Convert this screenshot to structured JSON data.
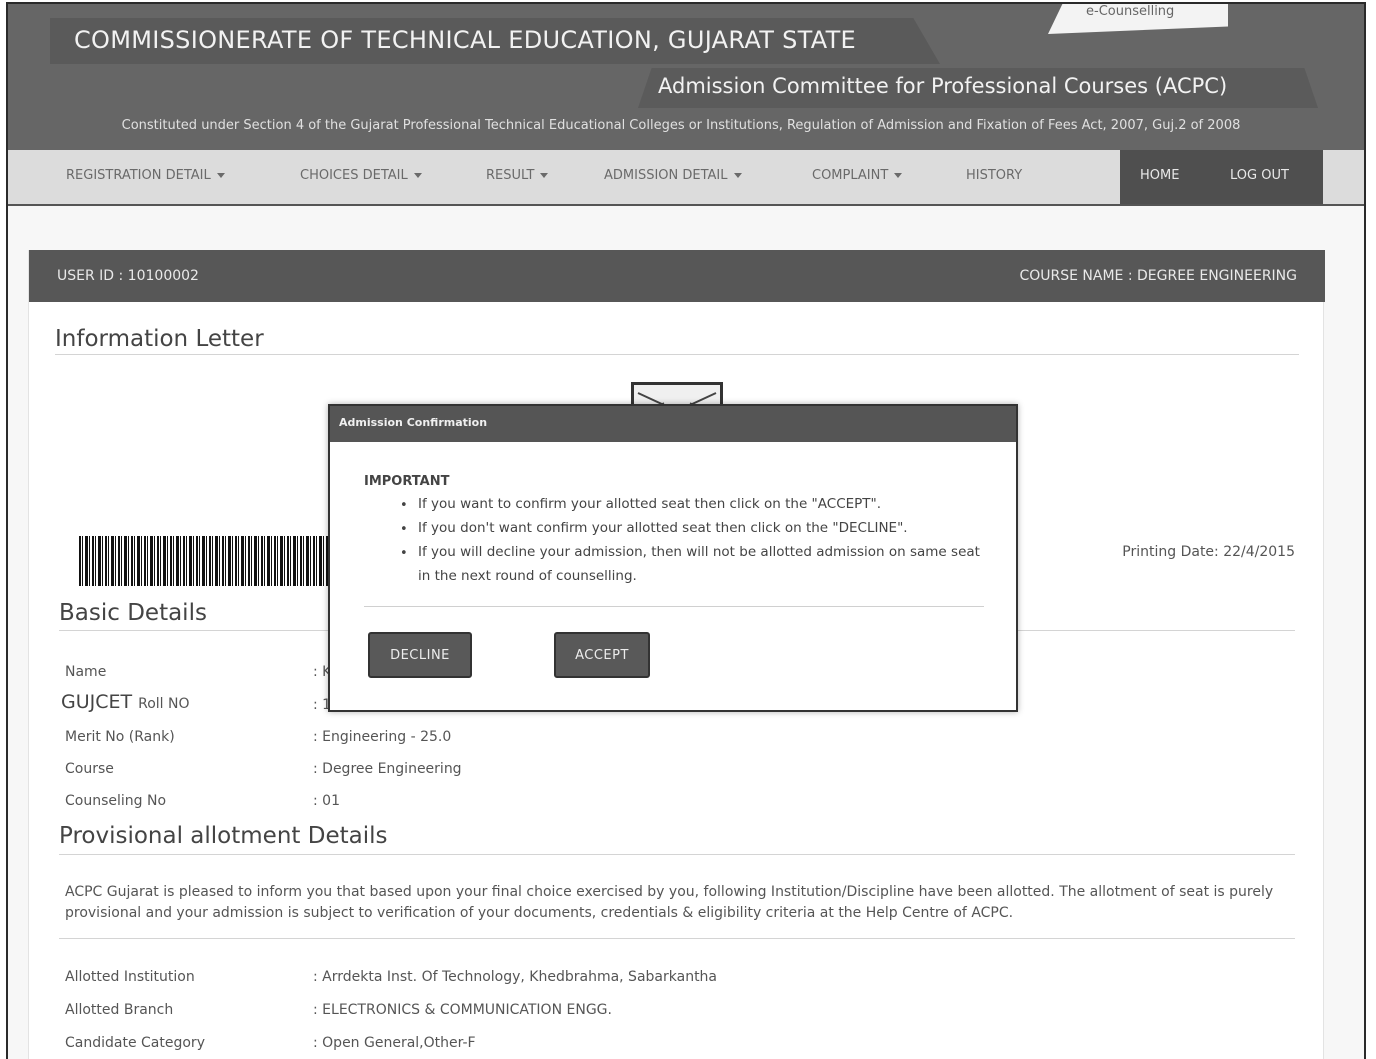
{
  "header": {
    "title": "COMMISSIONERATE OF TECHNICAL EDUCATION, GUJARAT STATE",
    "subtitle": "Admission Committee for Professional Courses (ACPC)",
    "corner_label": "e-Counselling",
    "act_line": "Constituted under Section 4 of the Gujarat Professional Technical Educational Colleges or Institutions, Regulation of Admission and Fixation of Fees Act, 2007, Guj.2 of 2008"
  },
  "nav": {
    "registration": "REGISTRATION DETAIL",
    "choices": "CHOICES DETAIL",
    "result": "RESULT",
    "admission": "ADMISSION DETAIL",
    "complaint": "COMPLAINT",
    "history": "HISTORY",
    "home": "HOME",
    "logout": "LOG OUT"
  },
  "userbar": {
    "user_id": "USER ID : 10100002",
    "course_name": "COURSE NAME : DEGREE ENGINEERING"
  },
  "letter": {
    "heading": "Information Letter",
    "printing_date": "Printing Date: 22/4/2015"
  },
  "basic": {
    "heading": "Basic Details",
    "name_label": "Name",
    "name_value": ": K",
    "gujcet_label": "GUJCET",
    "roll_label": "Roll NO",
    "roll_value": ": 1",
    "merit_label": "Merit No (Rank)",
    "merit_value": ": Engineering - 25.0",
    "course_label": "Course",
    "course_value": ": Degree Engineering",
    "counseling_label": "Counseling No",
    "counseling_value": ": 01"
  },
  "provisional": {
    "heading": "Provisional allotment Details",
    "paragraph": "ACPC Gujarat is pleased to inform you that based upon your final choice exercised by you, following Institution/Discipline have been allotted. The allotment of seat is purely provisional and your admission is subject to verification of your documents, credentials & eligibility criteria at the Help Centre of ACPC.",
    "institution_label": "Allotted Institution",
    "institution_value": ": Arrdekta Inst. Of Technology, Khedbrahma, Sabarkantha",
    "branch_label": "Allotted Branch",
    "branch_value": ": ELECTRONICS & COMMUNICATION ENGG.",
    "category_label": "Candidate Category",
    "category_value": ": Open General,Other-F"
  },
  "modal": {
    "title": "Admission Confirmation",
    "important": "IMPORTANT",
    "bullet1": "If you want to confirm your allotted seat then click on the \"ACCEPT\".",
    "bullet2": "If you don't want confirm your allotted seat then click on the \"DECLINE\".",
    "bullet3": "If you will decline your admission, then will not be allotted admission on same seat in the next round of counselling.",
    "decline": "DECLINE",
    "accept": "ACCEPT"
  },
  "colors": {
    "header_bg": "#666666",
    "nav_bg": "#dcdcdc",
    "bar_dark": "#575757",
    "button_bg": "#595959"
  },
  "icons": {
    "bullet": "•",
    "caret": "caret-down-icon"
  }
}
